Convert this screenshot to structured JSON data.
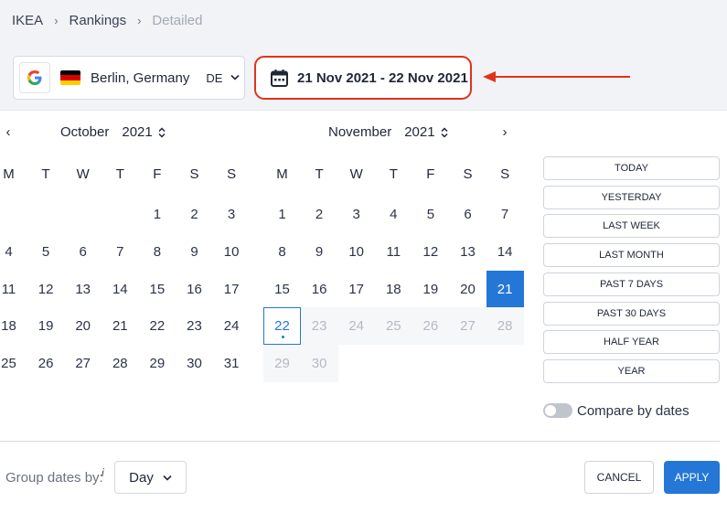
{
  "breadcrumb": [
    "IKEA",
    "Rankings",
    "Detailed"
  ],
  "location": {
    "name": "Berlin, Germany",
    "code": "DE",
    "engine_icon": "google-icon",
    "flag": "germany-flag"
  },
  "date_range": "21 Nov 2021 - 22 Nov 2021",
  "calendar": {
    "weekdays": [
      "M",
      "T",
      "W",
      "T",
      "F",
      "S",
      "S"
    ],
    "left": {
      "month": "October",
      "year": "2021",
      "days": [
        "1",
        "2",
        "3",
        "4",
        "5",
        "6",
        "7",
        "8",
        "9",
        "10",
        "11",
        "12",
        "13",
        "14",
        "15",
        "16",
        "17",
        "18",
        "19",
        "20",
        "21",
        "22",
        "23",
        "24",
        "25",
        "26",
        "27",
        "28",
        "29",
        "30",
        "31"
      ]
    },
    "right": {
      "month": "November",
      "year": "2021",
      "days": [
        "1",
        "2",
        "3",
        "4",
        "5",
        "6",
        "7",
        "8",
        "9",
        "10",
        "11",
        "12",
        "13",
        "14",
        "15",
        "16",
        "17",
        "18",
        "19",
        "20",
        "21",
        "22",
        "23",
        "24",
        "25",
        "26",
        "27",
        "28",
        "29",
        "30"
      ],
      "selected": "21",
      "today": "22"
    }
  },
  "presets": [
    "TODAY",
    "YESTERDAY",
    "LAST WEEK",
    "LAST MONTH",
    "PAST 7 DAYS",
    "PAST 30 DAYS",
    "HALF YEAR",
    "YEAR"
  ],
  "compare": {
    "label": "Compare by dates",
    "enabled": false
  },
  "group": {
    "label": "Group dates by:",
    "info": "i",
    "value": "Day"
  },
  "buttons": {
    "cancel": "CANCEL",
    "apply": "APPLY"
  },
  "colors": {
    "accent": "#2477d6",
    "highlight": "#e0331d"
  }
}
